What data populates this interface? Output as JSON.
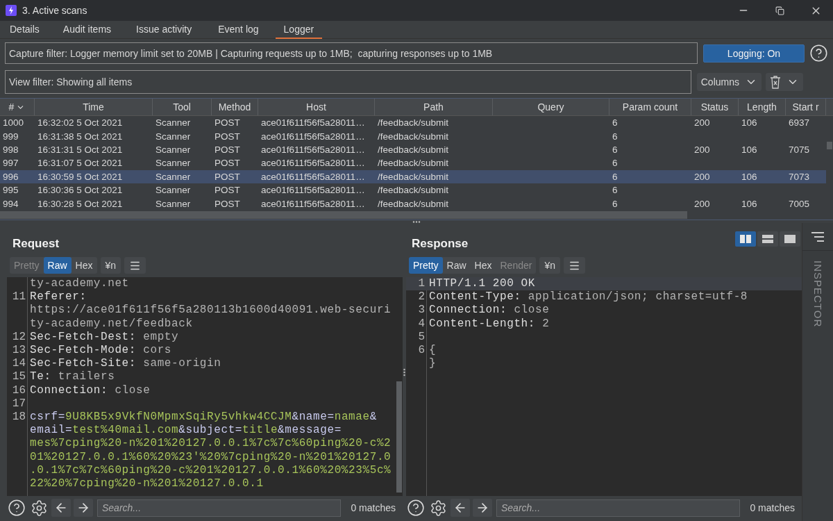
{
  "window": {
    "title": "3. Active scans"
  },
  "tabs": [
    {
      "label": "Details",
      "selected": false
    },
    {
      "label": "Audit items",
      "selected": false
    },
    {
      "label": "Issue activity",
      "selected": false
    },
    {
      "label": "Event log",
      "selected": false
    },
    {
      "label": "Logger",
      "selected": true
    }
  ],
  "capture_filter": {
    "value": "Capture filter: Logger memory limit set to 20MB | Capturing requests up to 1MB;  capturing responses up to 1MB"
  },
  "logging_button": {
    "label": "Logging: On",
    "on": true
  },
  "view_filter": {
    "value": "View filter: Showing all items"
  },
  "columns_button": {
    "label": "Columns"
  },
  "table": {
    "columns": [
      {
        "label": "#",
        "sorted": true
      },
      {
        "label": "Time",
        "sorted": false
      },
      {
        "label": "Tool",
        "sorted": false
      },
      {
        "label": "Method",
        "sorted": false
      },
      {
        "label": "Host",
        "sorted": false
      },
      {
        "label": "Path",
        "sorted": false
      },
      {
        "label": "Query",
        "sorted": false
      },
      {
        "label": "Param count",
        "sorted": false
      },
      {
        "label": "Status",
        "sorted": false
      },
      {
        "label": "Length",
        "sorted": false
      },
      {
        "label": "Start r",
        "sorted": false
      }
    ],
    "rows": [
      {
        "cells": [
          "1000",
          "16:32:02 5 Oct 2021",
          "Scanner",
          "POST",
          "ace01f611f56f5a28011…",
          "/feedback/submit",
          null,
          "6",
          "200",
          "106",
          "6937"
        ],
        "selected": false
      },
      {
        "cells": [
          "999",
          "16:31:38 5 Oct 2021",
          "Scanner",
          "POST",
          "ace01f611f56f5a28011…",
          "/feedback/submit",
          null,
          "6",
          null,
          null,
          null
        ],
        "selected": false
      },
      {
        "cells": [
          "998",
          "16:31:31 5 Oct 2021",
          "Scanner",
          "POST",
          "ace01f611f56f5a28011…",
          "/feedback/submit",
          null,
          "6",
          "200",
          "106",
          "7075"
        ],
        "selected": false
      },
      {
        "cells": [
          "997",
          "16:31:07 5 Oct 2021",
          "Scanner",
          "POST",
          "ace01f611f56f5a28011…",
          "/feedback/submit",
          null,
          "6",
          null,
          null,
          null
        ],
        "selected": false
      },
      {
        "cells": [
          "996",
          "16:30:59 5 Oct 2021",
          "Scanner",
          "POST",
          "ace01f611f56f5a28011…",
          "/feedback/submit",
          null,
          "6",
          "200",
          "106",
          "7073"
        ],
        "selected": true
      },
      {
        "cells": [
          "995",
          "16:30:36 5 Oct 2021",
          "Scanner",
          "POST",
          "ace01f611f56f5a28011…",
          "/feedback/submit",
          null,
          "6",
          null,
          null,
          null
        ],
        "selected": false
      },
      {
        "cells": [
          "994",
          "16:30:28 5 Oct 2021",
          "Scanner",
          "POST",
          "ace01f611f56f5a28011…",
          "/feedback/submit",
          null,
          "6",
          "200",
          "106",
          "7005"
        ],
        "selected": false
      }
    ]
  },
  "request": {
    "title": "Request",
    "format_tabs": [
      {
        "label": "Pretty",
        "selected": false,
        "disabled": true
      },
      {
        "label": "Raw",
        "selected": true,
        "disabled": false
      },
      {
        "label": "Hex",
        "selected": false,
        "disabled": false
      }
    ],
    "newline_button": {
      "label": "¥n"
    },
    "lines": [
      {
        "wraps": [
          {
            "parts": [
              {
                "text": "ty-academy.net",
                "kind": "value"
              }
            ]
          }
        ]
      },
      {
        "number": "11",
        "wraps": [
          {
            "parts": [
              {
                "text": "Referer:",
                "kind": "name"
              }
            ]
          },
          {
            "parts": [
              {
                "text": "https://ace01f611f56f5a280113b1600d40091.web-securi",
                "kind": "value"
              }
            ]
          },
          {
            "parts": [
              {
                "text": "ty-academy.net/feedback",
                "kind": "value"
              }
            ]
          }
        ]
      },
      {
        "number": "12",
        "wraps": [
          {
            "parts": [
              {
                "text": "Sec-Fetch-Dest:",
                "kind": "name"
              },
              {
                "text": " empty",
                "kind": "value"
              }
            ]
          }
        ]
      },
      {
        "number": "13",
        "wraps": [
          {
            "parts": [
              {
                "text": "Sec-Fetch-Mode:",
                "kind": "name"
              },
              {
                "text": " cors",
                "kind": "value"
              }
            ]
          }
        ]
      },
      {
        "number": "14",
        "wraps": [
          {
            "parts": [
              {
                "text": "Sec-Fetch-Site:",
                "kind": "name"
              },
              {
                "text": " same-origin",
                "kind": "value"
              }
            ]
          }
        ]
      },
      {
        "number": "15",
        "wraps": [
          {
            "parts": [
              {
                "text": "Te:",
                "kind": "name"
              },
              {
                "text": " trailers",
                "kind": "value"
              }
            ]
          }
        ]
      },
      {
        "number": "16",
        "wraps": [
          {
            "parts": [
              {
                "text": "Connection:",
                "kind": "name"
              },
              {
                "text": " close",
                "kind": "value"
              }
            ]
          }
        ]
      },
      {
        "number": "17"
      },
      {
        "number": "18",
        "wraps": [
          {
            "parts": [
              {
                "text": "csrf=",
                "kind": "key"
              },
              {
                "text": "9U8KB5x9VkfN0MpmxSqiRy5vhkw4CCJM",
                "kind": "val"
              },
              {
                "text": "&name=",
                "kind": "key"
              },
              {
                "text": "namae",
                "kind": "val"
              },
              {
                "text": "&",
                "kind": "key"
              }
            ]
          },
          {
            "parts": [
              {
                "text": "email=",
                "kind": "key"
              },
              {
                "text": "test%40mail.com",
                "kind": "val"
              },
              {
                "text": "&subject=",
                "kind": "key"
              },
              {
                "text": "title",
                "kind": "val"
              },
              {
                "text": "&message=",
                "kind": "key"
              }
            ]
          },
          {
            "parts": [
              {
                "text": "mes%7cping%20-n%201%20127.0.0.1%7c%7c%60ping%20-c%2",
                "kind": "val"
              }
            ]
          },
          {
            "parts": [
              {
                "text": "01%20127.0.0.1%60%20%23'%20%7cping%20-n%201%20127.0",
                "kind": "val"
              }
            ]
          },
          {
            "parts": [
              {
                "text": ".0.1%7c%7c%60ping%20-c%201%20127.0.0.1%60%20%23%5c%",
                "kind": "val"
              }
            ]
          },
          {
            "parts": [
              {
                "text": "22%20%7cping%20-n%201%20127.0.0.1",
                "kind": "val"
              }
            ]
          }
        ]
      }
    ],
    "search": {
      "placeholder": "Search..."
    },
    "matches": "0 matches"
  },
  "response": {
    "title": "Response",
    "view_modes": [
      {
        "kind": "columns",
        "selected": true
      },
      {
        "kind": "rows",
        "selected": false
      },
      {
        "kind": "single",
        "selected": false
      }
    ],
    "format_tabs": [
      {
        "label": "Pretty",
        "selected": true,
        "disabled": false
      },
      {
        "label": "Raw",
        "selected": false,
        "disabled": false
      },
      {
        "label": "Hex",
        "selected": false,
        "disabled": false
      },
      {
        "label": "Render",
        "selected": false,
        "disabled": true
      }
    ],
    "newline_button": {
      "label": "¥n"
    },
    "lines": [
      {
        "number": "1",
        "highlighted": true,
        "wraps": [
          {
            "parts": [
              {
                "text": "HTTP/1.1 200 OK",
                "kind": "name"
              }
            ]
          }
        ]
      },
      {
        "number": "2",
        "highlighted": false,
        "wraps": [
          {
            "parts": [
              {
                "text": "Content-Type:",
                "kind": "name"
              },
              {
                "text": " application/json; charset=utf-8",
                "kind": "value"
              }
            ]
          }
        ]
      },
      {
        "number": "3",
        "highlighted": false,
        "wraps": [
          {
            "parts": [
              {
                "text": "Connection:",
                "kind": "name"
              },
              {
                "text": " close",
                "kind": "value"
              }
            ]
          }
        ]
      },
      {
        "number": "4",
        "highlighted": false,
        "wraps": [
          {
            "parts": [
              {
                "text": "Content-Length:",
                "kind": "name"
              },
              {
                "text": " 2",
                "kind": "value"
              }
            ]
          }
        ]
      },
      {
        "number": "5",
        "highlighted": false
      },
      {
        "number": "6",
        "highlighted": false,
        "wraps": [
          {
            "parts": [
              {
                "text": "{",
                "kind": "value"
              }
            ]
          },
          {
            "parts": [
              {
                "text": "}",
                "kind": "value"
              }
            ]
          }
        ]
      }
    ],
    "search": {
      "placeholder": "Search..."
    },
    "matches": "0 matches"
  },
  "inspector": {
    "label": "INSPECTOR"
  }
}
